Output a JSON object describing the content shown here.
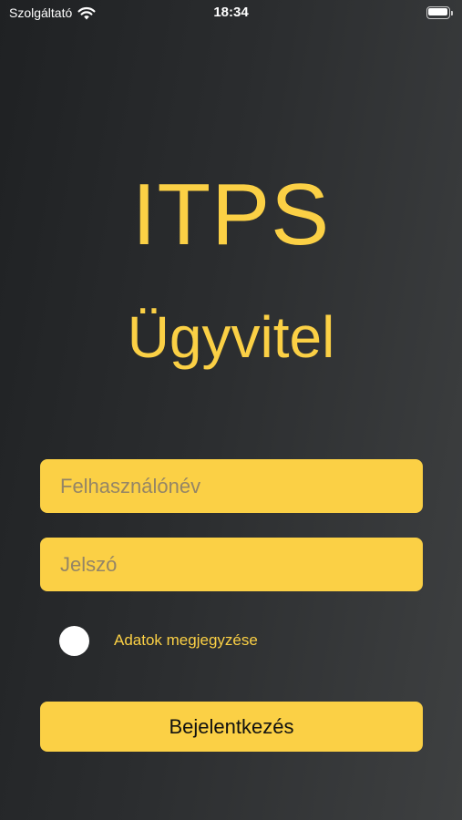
{
  "status_bar": {
    "carrier": "Szolgáltató",
    "time": "18:34",
    "battery_level": 1.0,
    "icons": [
      "wifi-icon",
      "battery-icon"
    ]
  },
  "header": {
    "title": "ITPS",
    "subtitle": "Ügyvitel"
  },
  "form": {
    "username_placeholder": "Felhasználónév",
    "username_value": "",
    "password_placeholder": "Jelszó",
    "password_value": "",
    "remember_label": "Adatok megjegyzése",
    "remember_checked": false,
    "login_label": "Bejelentkezés"
  },
  "colors": {
    "accent": "#fbd045",
    "background_dark": "#1f2123",
    "background_light": "#3e4041",
    "text_on_accent": "#111111"
  }
}
